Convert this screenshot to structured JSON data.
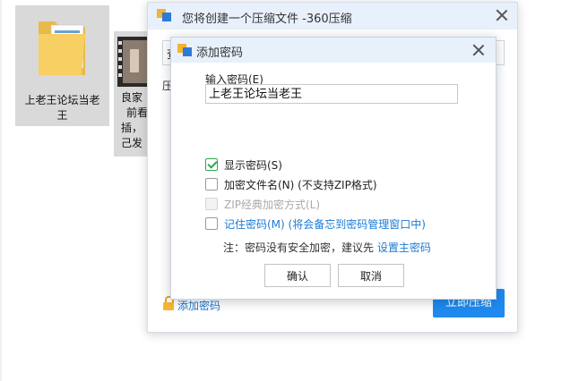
{
  "desktop": {
    "folder_caption_line1": "上老王论坛当老",
    "folder_caption_line2": "王",
    "video_caption_line1": "良家",
    "video_caption_line2": "前看",
    "video_caption_line3": "插，",
    "video_caption_line4": "己发"
  },
  "outer_dialog": {
    "title": "您将创建一个压缩文件 -360压缩",
    "input_partial": "查",
    "label_partial": "压",
    "add_password_label": "添加密码",
    "compress_button": "立即压缩"
  },
  "inner_dialog": {
    "title": "添加密码",
    "field_label": "输入密码(E)",
    "password_value": "上老王论坛当老王",
    "options": {
      "show_password": "显示密码(S)",
      "encrypt_filenames": "加密文件名(N) (不支持ZIP格式)",
      "zip_classic": "ZIP经典加密方式(L)",
      "remember_password": "记住密码(M) (将会备忘到密码管理窗口中)"
    },
    "note_text": "注：密码没有安全加密，建议先 ",
    "note_link": "设置主密码",
    "ok_button": "确认",
    "cancel_button": "取消"
  },
  "colors": {
    "accent": "#1f8af0",
    "link": "#1a7bd6",
    "check": "#2fa84f",
    "titlebar": "#e7f0fb"
  }
}
